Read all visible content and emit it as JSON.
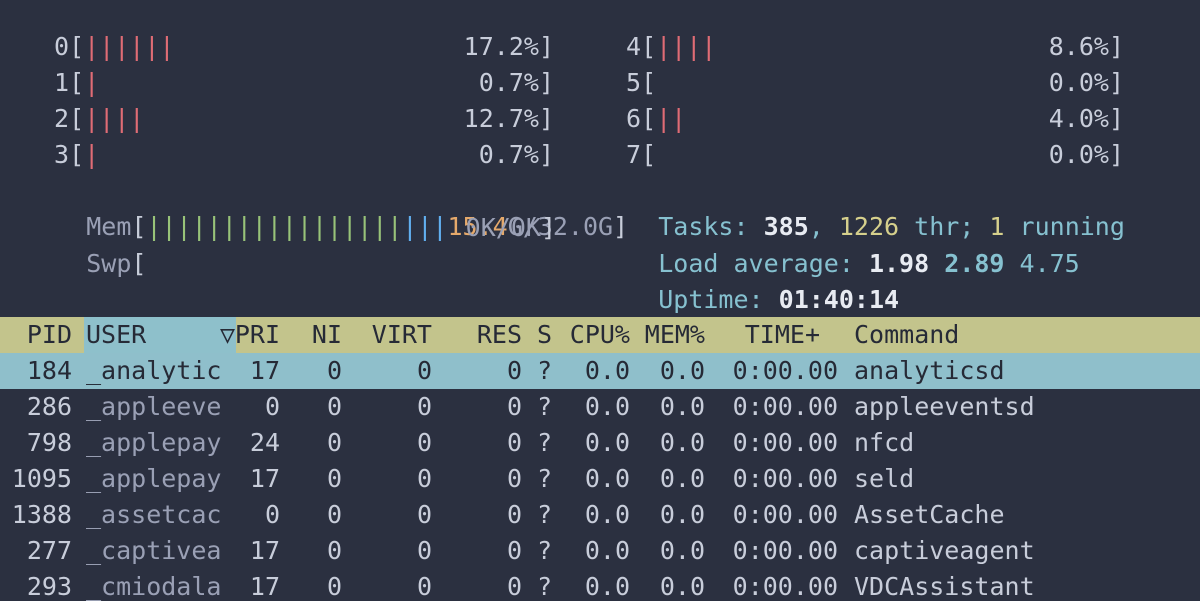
{
  "cpus_left": [
    {
      "id": "0",
      "bar": "||||||",
      "pct": "17.2%"
    },
    {
      "id": "1",
      "bar": "|",
      "pct": "0.7%"
    },
    {
      "id": "2",
      "bar": "||||",
      "pct": "12.7%"
    },
    {
      "id": "3",
      "bar": "|",
      "pct": "0.7%"
    }
  ],
  "cpus_right": [
    {
      "id": "4",
      "bar": "||||",
      "pct": "8.6%"
    },
    {
      "id": "5",
      "bar": "",
      "pct": "0.0%"
    },
    {
      "id": "6",
      "bar": "||",
      "pct": "4.0%"
    },
    {
      "id": "7",
      "bar": "",
      "pct": "0.0%"
    }
  ],
  "mem": {
    "label": "Mem",
    "bar_green": "|||||||||||||||||",
    "bar_blue": "|||",
    "used": "15.4",
    "total": "G/32.0G"
  },
  "swp": {
    "label": "Swp",
    "value": "0K/0K"
  },
  "tasks": {
    "label": "Tasks:",
    "count": "385",
    "thr": "1226",
    "thr_label": "thr;",
    "running": "1",
    "running_label": "running"
  },
  "load": {
    "label": "Load average:",
    "l1": "1.98",
    "l5": "2.89",
    "l15": "4.75"
  },
  "uptime": {
    "label": "Uptime:",
    "value": "01:40:14"
  },
  "columns": {
    "pid": "PID",
    "user": "USER",
    "sort": "▽",
    "pri": "PRI",
    "ni": "NI",
    "virt": "VIRT",
    "res": "RES",
    "s": "S",
    "cpu": "CPU%",
    "mem": "MEM%",
    "time": "TIME+",
    "command": "Command"
  },
  "processes": [
    {
      "pid": "184",
      "user": "_analytic",
      "pri": "17",
      "ni": "0",
      "virt": "0",
      "res": "0",
      "s": "?",
      "cpu": "0.0",
      "mem": "0.0",
      "time": "0:00.00",
      "command": "analyticsd"
    },
    {
      "pid": "286",
      "user": "_appleeve",
      "pri": "0",
      "ni": "0",
      "virt": "0",
      "res": "0",
      "s": "?",
      "cpu": "0.0",
      "mem": "0.0",
      "time": "0:00.00",
      "command": "appleeventsd"
    },
    {
      "pid": "798",
      "user": "_applepay",
      "pri": "24",
      "ni": "0",
      "virt": "0",
      "res": "0",
      "s": "?",
      "cpu": "0.0",
      "mem": "0.0",
      "time": "0:00.00",
      "command": "nfcd"
    },
    {
      "pid": "1095",
      "user": "_applepay",
      "pri": "17",
      "ni": "0",
      "virt": "0",
      "res": "0",
      "s": "?",
      "cpu": "0.0",
      "mem": "0.0",
      "time": "0:00.00",
      "command": "seld"
    },
    {
      "pid": "1388",
      "user": "_assetcac",
      "pri": "0",
      "ni": "0",
      "virt": "0",
      "res": "0",
      "s": "?",
      "cpu": "0.0",
      "mem": "0.0",
      "time": "0:00.00",
      "command": "AssetCache"
    },
    {
      "pid": "277",
      "user": "_captivea",
      "pri": "17",
      "ni": "0",
      "virt": "0",
      "res": "0",
      "s": "?",
      "cpu": "0.0",
      "mem": "0.0",
      "time": "0:00.00",
      "command": "captiveagent"
    },
    {
      "pid": "293",
      "user": "_cmiodala",
      "pri": "17",
      "ni": "0",
      "virt": "0",
      "res": "0",
      "s": "?",
      "cpu": "0.0",
      "mem": "0.0",
      "time": "0:00.00",
      "command": "VDCAssistant"
    }
  ],
  "colors": {
    "background": "#2b3040",
    "header_bg": "#c3c48c",
    "selected_bg": "#8fbfcb",
    "cpu_bar": "#e06c75"
  }
}
